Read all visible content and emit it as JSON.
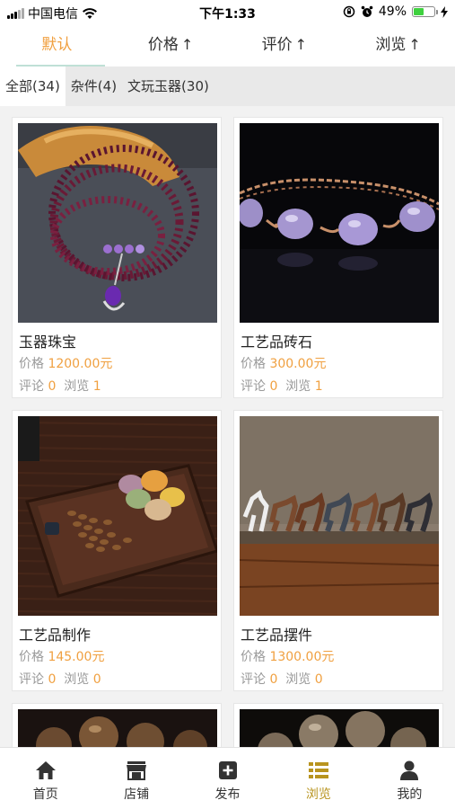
{
  "status_bar": {
    "carrier": "中国电信",
    "time": "下午1:33",
    "battery": "49%",
    "battery_level": 0.49
  },
  "sort_tabs": [
    {
      "label": "默认",
      "arrow": ""
    },
    {
      "label": "价格",
      "arrow": "↑"
    },
    {
      "label": "评价",
      "arrow": "↑"
    },
    {
      "label": "浏览",
      "arrow": "↑"
    }
  ],
  "categories": [
    {
      "label": "全部(34)"
    },
    {
      "label": "杂件(4)"
    },
    {
      "label": "文玩玉器(30)"
    }
  ],
  "product_labels": {
    "price_prefix": "价格",
    "comments_prefix": "评论",
    "views_prefix": "浏览"
  },
  "products": [
    {
      "name": "玉器珠宝",
      "price": "1200.00元",
      "comments": "0",
      "views": "1"
    },
    {
      "name": "工艺品砖石",
      "price": "300.00元",
      "comments": "0",
      "views": "1"
    },
    {
      "name": "工艺品制作",
      "price": "145.00元",
      "comments": "0",
      "views": "0"
    },
    {
      "name": "工艺品摆件",
      "price": "1300.00元",
      "comments": "0",
      "views": "0"
    }
  ],
  "tab_bar": [
    {
      "label": "首页",
      "icon": "home-icon"
    },
    {
      "label": "店铺",
      "icon": "store-icon"
    },
    {
      "label": "发布",
      "icon": "publish-icon"
    },
    {
      "label": "浏览",
      "icon": "list-icon"
    },
    {
      "label": "我的",
      "icon": "user-icon"
    }
  ],
  "colors": {
    "accent": "#f0a040",
    "tab_active": "#b8941f"
  }
}
